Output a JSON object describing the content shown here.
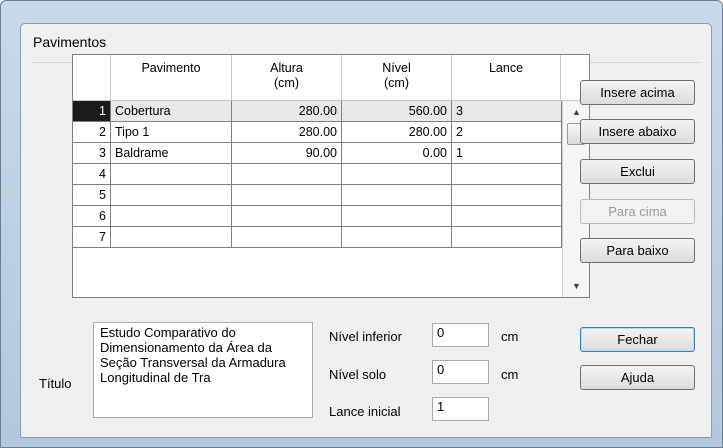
{
  "dialog": {
    "title": "Pavimentos"
  },
  "table": {
    "headers": [
      "Pavimento",
      "Altura (cm)",
      "Nível (cm)",
      "Lance"
    ],
    "rows": [
      {
        "n": "1",
        "pavimento": "Cobertura",
        "altura": "280.00",
        "nivel": "560.00",
        "lance": "3"
      },
      {
        "n": "2",
        "pavimento": "Tipo 1",
        "altura": "280.00",
        "nivel": "280.00",
        "lance": "2"
      },
      {
        "n": "3",
        "pavimento": "Baldrame",
        "altura": "90.00",
        "nivel": "0.00",
        "lance": "1"
      },
      {
        "n": "4",
        "pavimento": "",
        "altura": "",
        "nivel": "",
        "lance": ""
      },
      {
        "n": "5",
        "pavimento": "",
        "altura": "",
        "nivel": "",
        "lance": ""
      },
      {
        "n": "6",
        "pavimento": "",
        "altura": "",
        "nivel": "",
        "lance": ""
      },
      {
        "n": "7",
        "pavimento": "",
        "altura": "",
        "nivel": "",
        "lance": ""
      }
    ]
  },
  "buttons": {
    "insere_acima": "Insere acima",
    "insere_abaixo": "Insere abaixo",
    "exclui": "Exclui",
    "para_cima": "Para cima",
    "para_baixo": "Para baixo",
    "fechar": "Fechar",
    "ajuda": "Ajuda"
  },
  "form": {
    "titulo_label": "Título",
    "titulo_value": "Estudo Comparativo do Dimensionamento da Área da Seção Transversal da Armadura Longitudinal de Tra",
    "nivel_inferior_label": "Nível inferior",
    "nivel_inferior_value": "0",
    "nivel_solo_label": "Nível solo",
    "nivel_solo_value": "0",
    "lance_inicial_label": "Lance inicial",
    "lance_inicial_value": "1",
    "unit": "cm"
  }
}
